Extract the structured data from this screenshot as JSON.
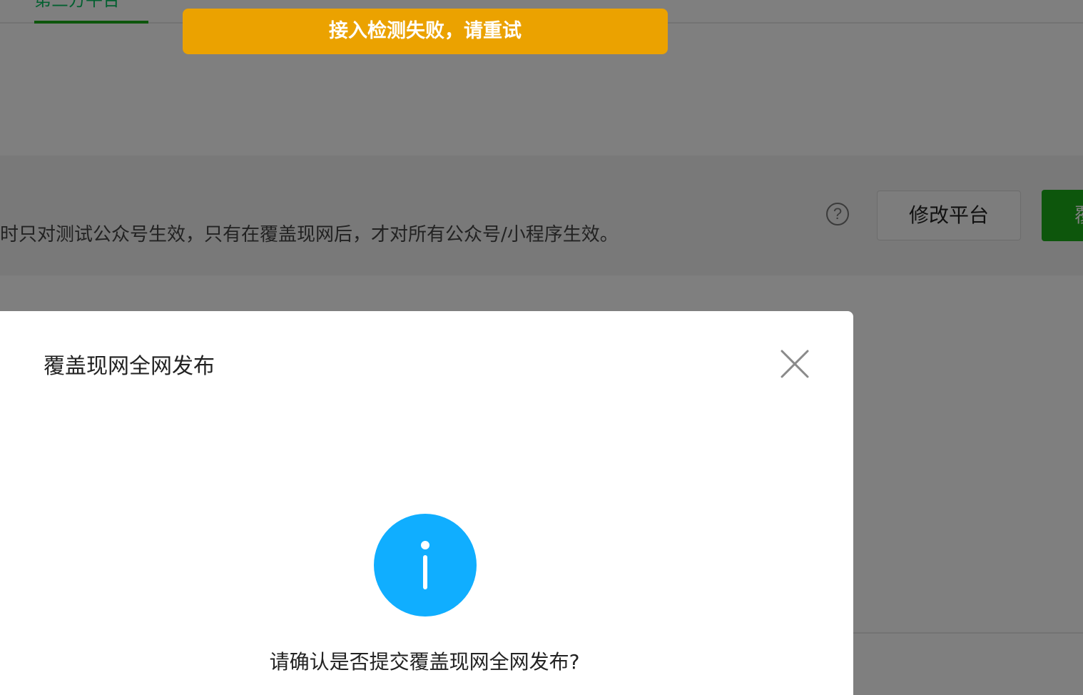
{
  "tabs": {
    "active_label": "第三方平台"
  },
  "notice": {
    "text": "时只对测试公众号生效，只有在覆盖现网后，才对所有公众号/小程序生效。",
    "modify_button": "修改平台",
    "publish_button": "覆"
  },
  "toast": {
    "message": "接入检测失败，请重试",
    "color": "#eba200"
  },
  "dialog": {
    "title": "覆盖现网全网发布",
    "message": "请确认是否提交覆盖现网全网发布?",
    "icon_color": "#10aeff",
    "close_icon": "close-icon",
    "info_icon": "info-icon"
  },
  "colors": {
    "brand_green": "#1aad19",
    "mask": "rgba(0,0,0,0.5)"
  }
}
